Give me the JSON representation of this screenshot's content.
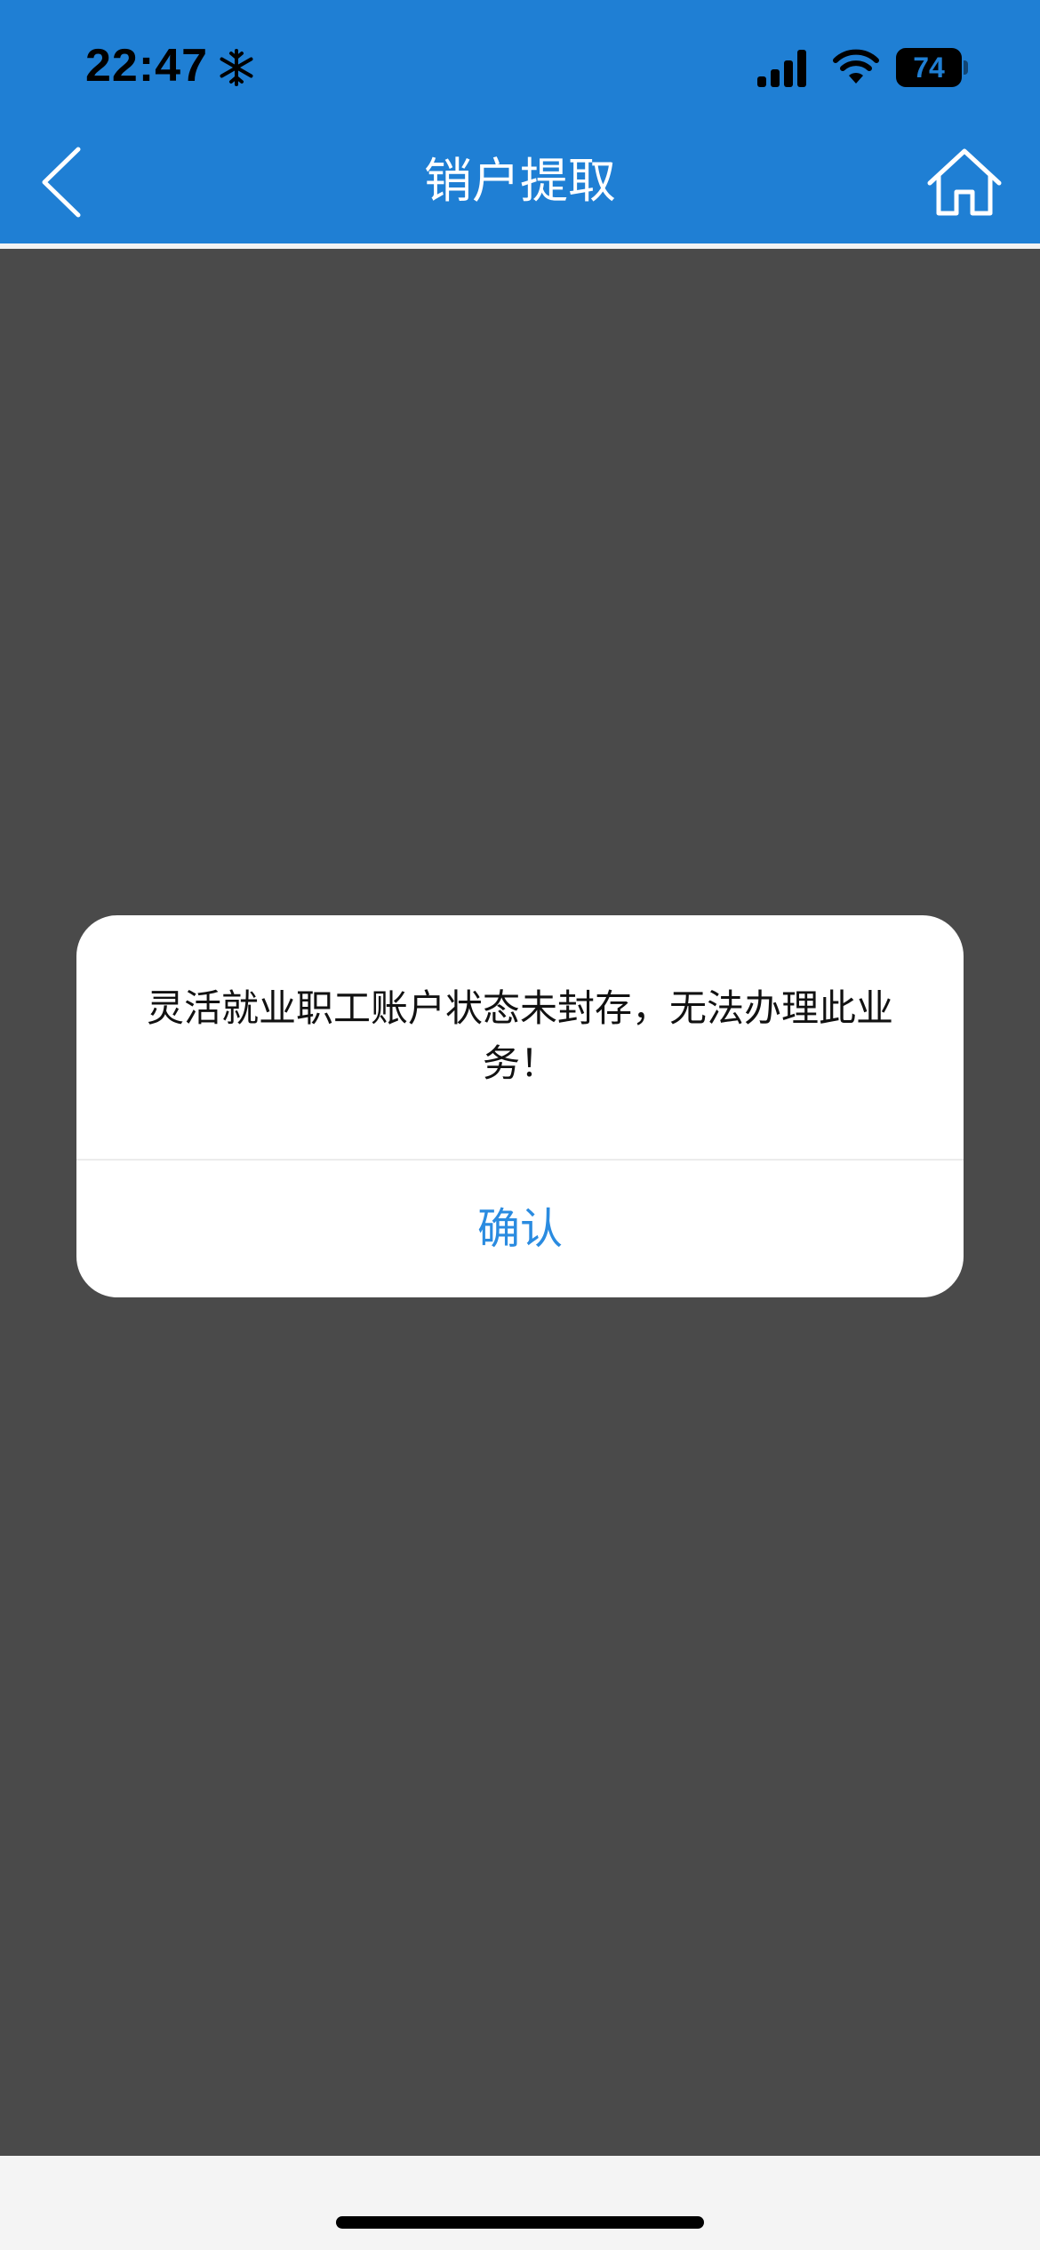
{
  "status_bar": {
    "time": "22:47",
    "battery_level": "74",
    "icons": [
      "snowflake-icon",
      "signal-icon",
      "wifi-icon",
      "battery-icon"
    ]
  },
  "nav": {
    "title": "销户提取",
    "back_icon": "chevron-left-icon",
    "home_icon": "home-icon"
  },
  "dialog": {
    "message": "灵活就业职工账户状态未封存，无法办理此业务！",
    "confirm_label": "确认"
  },
  "colors": {
    "header": "#1f7fd4",
    "overlay": "#4a4a4a",
    "dialog_bg": "#ffffff",
    "accent": "#2a8be0"
  }
}
